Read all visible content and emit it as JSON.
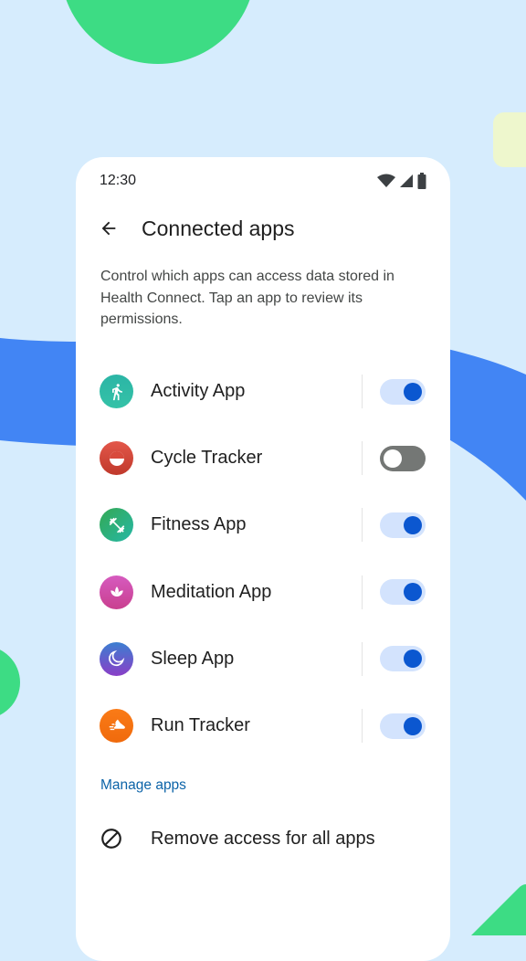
{
  "status_bar": {
    "time": "12:30",
    "icons": [
      "wifi-icon",
      "cellular-signal-icon",
      "battery-icon"
    ]
  },
  "header": {
    "back_icon": "arrow-back-icon",
    "title": "Connected apps"
  },
  "description": "Control which apps can access data stored in Health Connect. Tap an app to review its permissions.",
  "apps": [
    {
      "name": "Activity App",
      "icon": "running-person-icon",
      "color_from": "#2bb5a6",
      "color_to": "#35c2a7",
      "enabled": true
    },
    {
      "name": "Cycle Tracker",
      "icon": "half-circle-icon",
      "color_from": "#e3574a",
      "color_to": "#c0392b",
      "enabled": false
    },
    {
      "name": "Fitness App",
      "icon": "dumbbell-icon",
      "color_from": "#34a853",
      "color_to": "#26b8a6",
      "enabled": true
    },
    {
      "name": "Meditation App",
      "icon": "lotus-icon",
      "color_from": "#d65bbf",
      "color_to": "#c93f8f",
      "enabled": true
    },
    {
      "name": "Sleep App",
      "icon": "moon-icon",
      "color_from": "#3c7fd1",
      "color_to": "#8a3fc7",
      "enabled": true
    },
    {
      "name": "Run Tracker",
      "icon": "running-shoe-icon",
      "color_from": "#fa7b17",
      "color_to": "#f06a0c",
      "enabled": true
    }
  ],
  "manage": {
    "section_title": "Manage apps",
    "remove_all_label": "Remove access for all apps",
    "remove_all_icon": "block-icon"
  },
  "colors": {
    "background": "#d6ecfd",
    "toggle_on_track": "#d3e3fd",
    "toggle_on_knob": "#0b57d0",
    "toggle_off_track": "#747775",
    "link_blue": "#0b63a8"
  }
}
